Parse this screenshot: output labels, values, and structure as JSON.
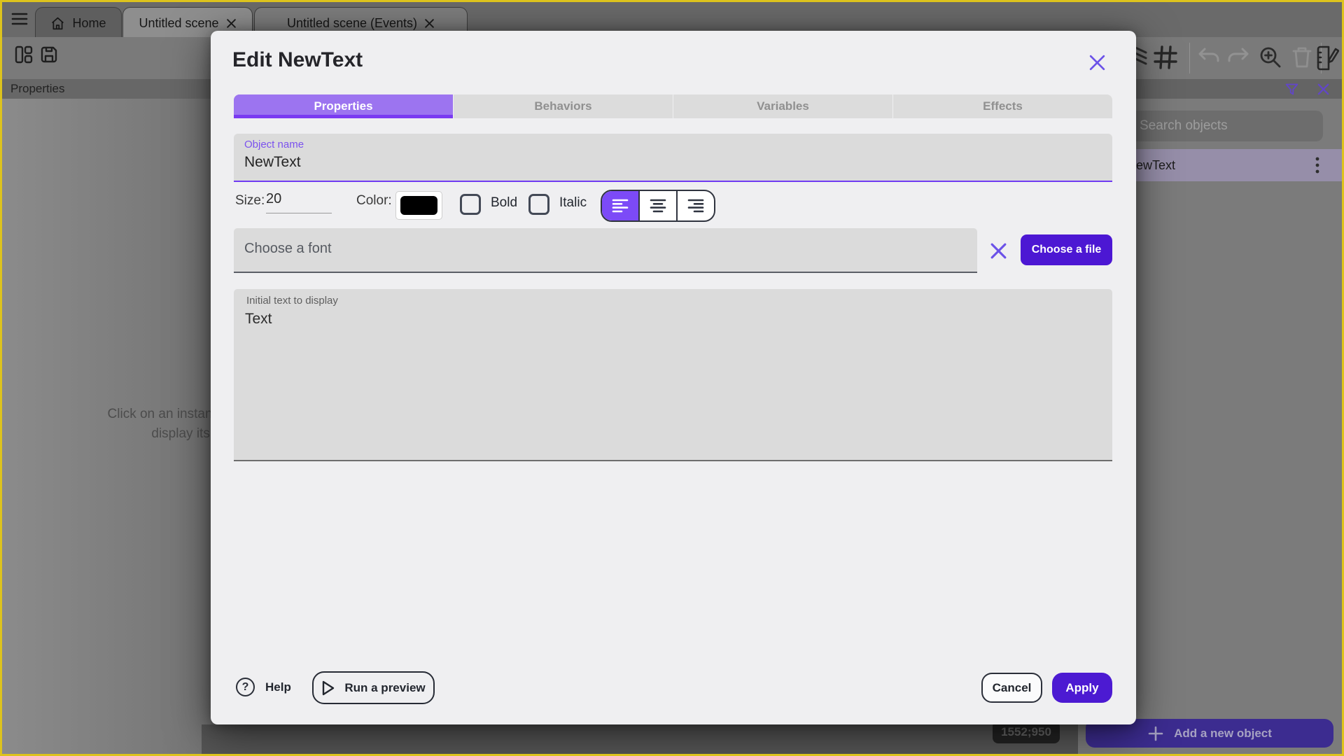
{
  "tabbar": {
    "tabs": [
      {
        "label": "Home"
      },
      {
        "label": "Untitled scene"
      },
      {
        "label": "Untitled scene (Events)"
      }
    ]
  },
  "left_panel": {
    "header": "Properties",
    "empty_line1": "Click on an instance in the scene to",
    "empty_line2": "display its properties"
  },
  "canvas": {
    "coordinates": "1552;950"
  },
  "objects_panel": {
    "search_placeholder": "Search objects",
    "items": [
      {
        "name": "NewText"
      }
    ],
    "add_button_label": "Add a new object"
  },
  "dialog": {
    "title": "Edit NewText",
    "tabs": [
      "Properties",
      "Behaviors",
      "Variables",
      "Effects"
    ],
    "active_tab": "Properties",
    "object_name": {
      "label": "Object name",
      "value": "NewText"
    },
    "size_label": "Size:",
    "size_value": "20",
    "color_label": "Color:",
    "bold_label": "Bold",
    "italic_label": "Italic",
    "font_placeholder": "Choose a font",
    "choose_file_label": "Choose a file",
    "initial_text": {
      "label": "Initial text to display",
      "value": "Text"
    },
    "footer": {
      "help_label": "Help",
      "run_preview_label": "Run a preview",
      "cancel_label": "Cancel",
      "apply_label": "Apply"
    }
  },
  "icons": {
    "hamburger": "menu",
    "home": "house",
    "tab_close": "x",
    "panel_layout": "split-columns",
    "save": "floppy",
    "layers": "stacked-sheets",
    "grid": "#",
    "undo": "arrow-left-curve",
    "redo": "arrow-right-curve",
    "zoom_in": "magnifier-plus",
    "trash": "bin",
    "edit_events": "book-pencil",
    "filter": "funnel",
    "panel_close": "x",
    "kebab": "vertical-dots",
    "plus": "+",
    "help": "?",
    "play": "triangle-right",
    "clear": "x"
  },
  "colors": {
    "accent_purple": "#7c4af7",
    "deep_purple": "#4c17d3",
    "active_tab_purple": "#9c74f0",
    "tab_underline": "#7a3af2",
    "label_purple": "#7b52ee",
    "frame_yellow": "#ddc31d",
    "swatch_black": "#000000"
  }
}
